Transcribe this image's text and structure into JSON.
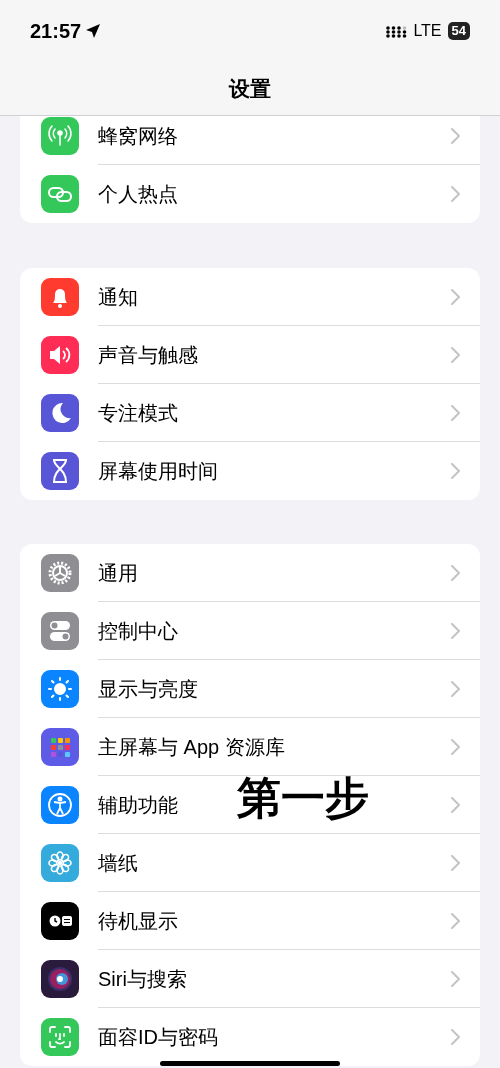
{
  "status_bar": {
    "time": "21:57",
    "network": "LTE",
    "battery": "54"
  },
  "title": "设置",
  "groups": [
    {
      "items": [
        {
          "label": "蜂窝网络"
        },
        {
          "label": "个人热点"
        }
      ]
    },
    {
      "items": [
        {
          "label": "通知"
        },
        {
          "label": "声音与触感"
        },
        {
          "label": "专注模式"
        },
        {
          "label": "屏幕使用时间"
        }
      ]
    },
    {
      "items": [
        {
          "label": "通用"
        },
        {
          "label": "控制中心"
        },
        {
          "label": "显示与亮度"
        },
        {
          "label": "主屏幕与 App 资源库"
        },
        {
          "label": "辅助功能"
        },
        {
          "label": "墙纸"
        },
        {
          "label": "待机显示"
        },
        {
          "label": "Siri与搜索"
        },
        {
          "label": "面容ID与密码"
        }
      ]
    }
  ],
  "annotation": "第一步"
}
